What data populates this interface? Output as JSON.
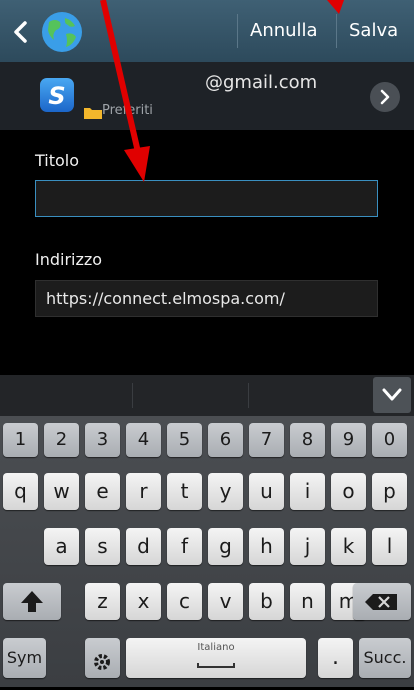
{
  "action_bar": {
    "cancel_label": "Annulla",
    "save_label": "Salva"
  },
  "account": {
    "email": "@gmail.com",
    "folder_label": "Preferiti"
  },
  "form": {
    "title_label": "Titolo",
    "title_value": "",
    "address_label": "Indirizzo",
    "address_value": "https://connect.elmospa.com/"
  },
  "keyboard": {
    "row_numbers": [
      "1",
      "2",
      "3",
      "4",
      "5",
      "6",
      "7",
      "8",
      "9",
      "0"
    ],
    "row_top": [
      "q",
      "w",
      "e",
      "r",
      "t",
      "y",
      "u",
      "i",
      "o",
      "p"
    ],
    "row_middle": [
      "a",
      "s",
      "d",
      "f",
      "g",
      "h",
      "j",
      "k",
      "l"
    ],
    "row_bottom": [
      "z",
      "x",
      "c",
      "v",
      "b",
      "n",
      "m"
    ],
    "sym_label": "Sym",
    "space_label": "Italiano",
    "period_label": ".",
    "next_label": "Succ."
  },
  "colors": {
    "annotation_arrow": "#e00000",
    "accent_focus": "#3a8fc0"
  }
}
